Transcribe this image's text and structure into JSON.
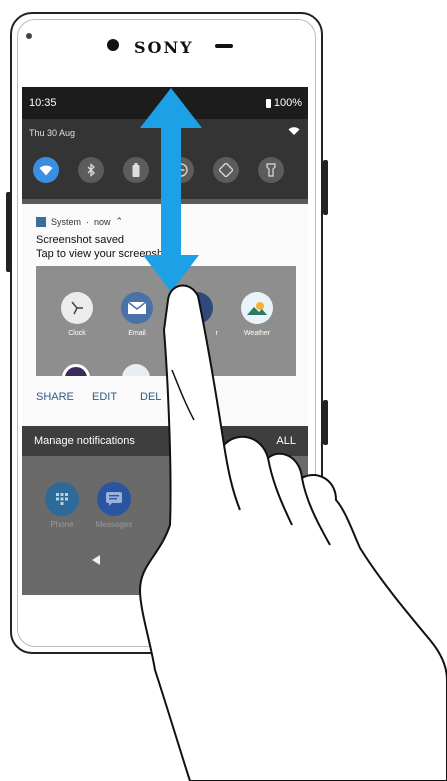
{
  "device": {
    "brand": "SONY"
  },
  "statusbar": {
    "time": "10:35",
    "battery": "100%"
  },
  "quick_settings": {
    "date": "Thu 30 Aug",
    "tiles": [
      {
        "icon": "wifi-icon",
        "active": true
      },
      {
        "icon": "bluetooth-icon",
        "active": false
      },
      {
        "icon": "battery-icon",
        "active": false
      },
      {
        "icon": "do-not-disturb-icon",
        "active": false
      },
      {
        "icon": "auto-rotate-icon",
        "active": false
      },
      {
        "icon": "flashlight-icon",
        "active": false
      }
    ]
  },
  "notification": {
    "app": "System",
    "time": "now",
    "title": "Screenshot saved",
    "text": "Tap to view your screensh",
    "preview_apps": [
      {
        "label": "Clock",
        "icon": "clock-icon"
      },
      {
        "label": "Email",
        "icon": "email-icon"
      },
      {
        "label": "r",
        "icon": "calendar-icon"
      },
      {
        "label": "Weather",
        "icon": "weather-icon"
      }
    ],
    "actions": [
      "SHARE",
      "EDIT",
      "DEL"
    ]
  },
  "manage_bar": {
    "manage": "Manage notifications",
    "clear": "ALL"
  },
  "dock": [
    {
      "label": "Phone",
      "icon": "phone-icon"
    },
    {
      "label": "Messages",
      "icon": "messages-icon"
    }
  ],
  "colors": {
    "accent": "#3a8fe0",
    "arrow": "#1da1e6"
  }
}
